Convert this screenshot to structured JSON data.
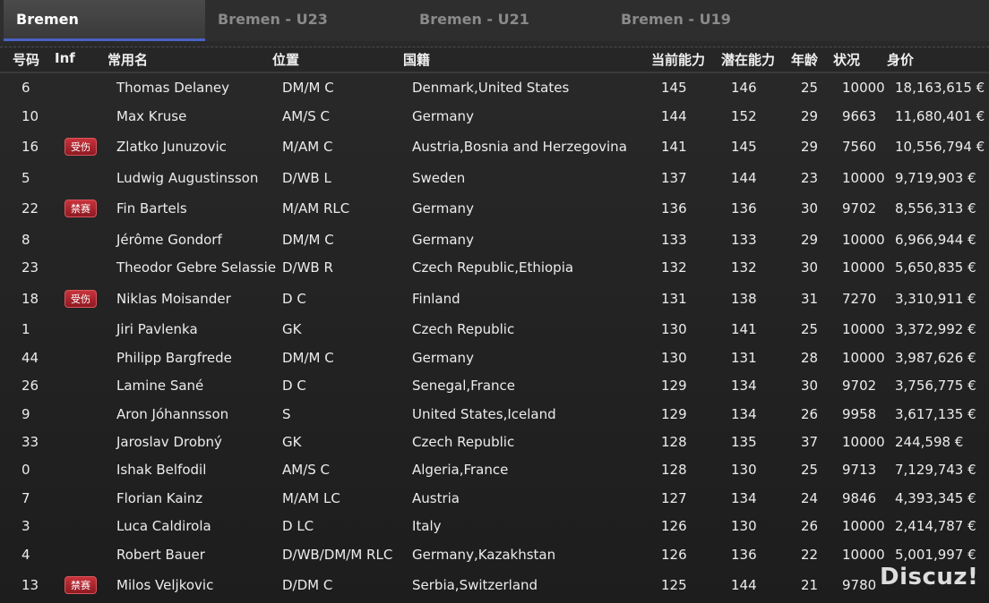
{
  "tabs": [
    {
      "label": "Bremen",
      "active": true
    },
    {
      "label": "Bremen - U23",
      "active": false
    },
    {
      "label": "Bremen - U21",
      "active": false
    },
    {
      "label": "Bremen - U19",
      "active": false
    }
  ],
  "columns": {
    "num": "号码",
    "inf": "Inf",
    "name": "常用名",
    "pos": "位置",
    "nat": "国籍",
    "ca": "当前能力",
    "pa": "潜在能力",
    "age": "年龄",
    "cond": "状况",
    "value": "身价"
  },
  "players": [
    {
      "num": "6",
      "inf": "",
      "name": "Thomas Delaney",
      "pos": "DM/M C",
      "nat": "Denmark,United States",
      "ca": "145",
      "pa": "146",
      "age": "25",
      "cond": "10000",
      "value": "18,163,615 €"
    },
    {
      "num": "10",
      "inf": "",
      "name": "Max Kruse",
      "pos": "AM/S C",
      "nat": "Germany",
      "ca": "144",
      "pa": "152",
      "age": "29",
      "cond": "9663",
      "value": "11,680,401 €"
    },
    {
      "num": "16",
      "inf": "受伤",
      "name": "Zlatko Junuzovic",
      "pos": "M/AM C",
      "nat": "Austria,Bosnia and Herzegovina",
      "ca": "141",
      "pa": "145",
      "age": "29",
      "cond": "7560",
      "value": "10,556,794 €"
    },
    {
      "num": "5",
      "inf": "",
      "name": "Ludwig Augustinsson",
      "pos": "D/WB L",
      "nat": "Sweden",
      "ca": "137",
      "pa": "144",
      "age": "23",
      "cond": "10000",
      "value": "9,719,903 €"
    },
    {
      "num": "22",
      "inf": "禁赛",
      "name": "Fin Bartels",
      "pos": "M/AM RLC",
      "nat": "Germany",
      "ca": "136",
      "pa": "136",
      "age": "30",
      "cond": "9702",
      "value": "8,556,313 €"
    },
    {
      "num": "8",
      "inf": "",
      "name": "Jérôme Gondorf",
      "pos": "DM/M C",
      "nat": "Germany",
      "ca": "133",
      "pa": "133",
      "age": "29",
      "cond": "10000",
      "value": "6,966,944 €"
    },
    {
      "num": "23",
      "inf": "",
      "name": "Theodor Gebre Selassie",
      "pos": "D/WB R",
      "nat": "Czech Republic,Ethiopia",
      "ca": "132",
      "pa": "132",
      "age": "30",
      "cond": "10000",
      "value": "5,650,835 €"
    },
    {
      "num": "18",
      "inf": "受伤",
      "name": "Niklas Moisander",
      "pos": "D C",
      "nat": "Finland",
      "ca": "131",
      "pa": "138",
      "age": "31",
      "cond": "7270",
      "value": "3,310,911 €"
    },
    {
      "num": "1",
      "inf": "",
      "name": "Jiri Pavlenka",
      "pos": "GK",
      "nat": "Czech Republic",
      "ca": "130",
      "pa": "141",
      "age": "25",
      "cond": "10000",
      "value": "3,372,992 €"
    },
    {
      "num": "44",
      "inf": "",
      "name": "Philipp Bargfrede",
      "pos": "DM/M C",
      "nat": "Germany",
      "ca": "130",
      "pa": "131",
      "age": "28",
      "cond": "10000",
      "value": "3,987,626 €"
    },
    {
      "num": "26",
      "inf": "",
      "name": "Lamine Sané",
      "pos": "D C",
      "nat": "Senegal,France",
      "ca": "129",
      "pa": "134",
      "age": "30",
      "cond": "9702",
      "value": "3,756,775 €"
    },
    {
      "num": "9",
      "inf": "",
      "name": "Aron Jóhannsson",
      "pos": "S",
      "nat": "United States,Iceland",
      "ca": "129",
      "pa": "134",
      "age": "26",
      "cond": "9958",
      "value": "3,617,135 €"
    },
    {
      "num": "33",
      "inf": "",
      "name": "Jaroslav Drobný",
      "pos": "GK",
      "nat": "Czech Republic",
      "ca": "128",
      "pa": "135",
      "age": "37",
      "cond": "10000",
      "value": "244,598 €"
    },
    {
      "num": "0",
      "inf": "",
      "name": "Ishak Belfodil",
      "pos": "AM/S C",
      "nat": "Algeria,France",
      "ca": "128",
      "pa": "130",
      "age": "25",
      "cond": "9713",
      "value": "7,129,743 €"
    },
    {
      "num": "7",
      "inf": "",
      "name": "Florian Kainz",
      "pos": "M/AM LC",
      "nat": "Austria",
      "ca": "127",
      "pa": "134",
      "age": "24",
      "cond": "9846",
      "value": "4,393,345 €"
    },
    {
      "num": "3",
      "inf": "",
      "name": "Luca Caldirola",
      "pos": "D LC",
      "nat": "Italy",
      "ca": "126",
      "pa": "130",
      "age": "26",
      "cond": "10000",
      "value": "2,414,787 €"
    },
    {
      "num": "4",
      "inf": "",
      "name": "Robert Bauer",
      "pos": "D/WB/DM/M RLC",
      "nat": "Germany,Kazakhstan",
      "ca": "126",
      "pa": "136",
      "age": "22",
      "cond": "10000",
      "value": "5,001,997 €"
    },
    {
      "num": "13",
      "inf": "禁赛",
      "name": "Milos Veljkovic",
      "pos": "D/DM C",
      "nat": "Serbia,Switzerland",
      "ca": "125",
      "pa": "144",
      "age": "21",
      "cond": "9780",
      "value": ""
    }
  ],
  "watermark": "Discuz!"
}
